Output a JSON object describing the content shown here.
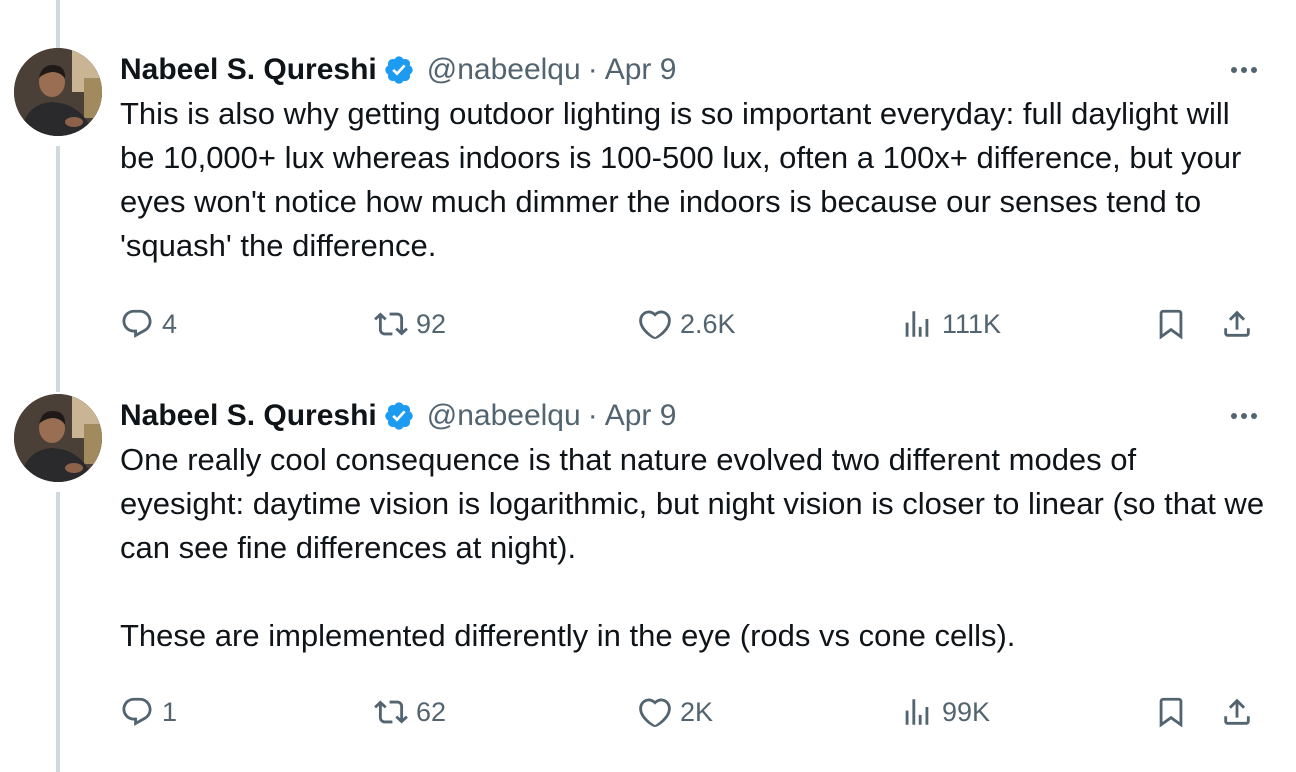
{
  "tweets": [
    {
      "author": {
        "display_name": "Nabeel S. Qureshi",
        "handle": "@nabeelqu",
        "verified": true
      },
      "separator": "·",
      "date": "Apr 9",
      "paragraphs": [
        "This is also why getting outdoor lighting is so important everyday: full daylight will be 10,000+ lux whereas indoors is 100-500 lux, often a 100x+ difference, but your eyes won't notice how much dimmer the indoors is because our senses tend to 'squash' the difference."
      ],
      "stats": {
        "replies": "4",
        "reposts": "92",
        "likes": "2.6K",
        "views": "111K"
      }
    },
    {
      "author": {
        "display_name": "Nabeel S. Qureshi",
        "handle": "@nabeelqu",
        "verified": true
      },
      "separator": "·",
      "date": "Apr 9",
      "paragraphs": [
        "One really cool consequence is that nature evolved two different modes of eyesight: daytime vision is logarithmic, but night vision is closer to linear (so that we can see fine differences at night).",
        "These are implemented differently in the eye (rods vs cone cells)."
      ],
      "stats": {
        "replies": "1",
        "reposts": "62",
        "likes": "2K",
        "views": "99K"
      }
    }
  ],
  "icons": {
    "verified": "verified-badge-icon",
    "more": "more-options-icon",
    "reply": "reply-icon",
    "repost": "repost-icon",
    "like": "heart-icon",
    "views": "views-icon",
    "bookmark": "bookmark-icon",
    "share": "share-icon"
  },
  "colors": {
    "text_primary": "#0f1419",
    "text_secondary": "#536471",
    "verified_blue": "#1d9bf0",
    "thread_line": "#cfd9de"
  }
}
